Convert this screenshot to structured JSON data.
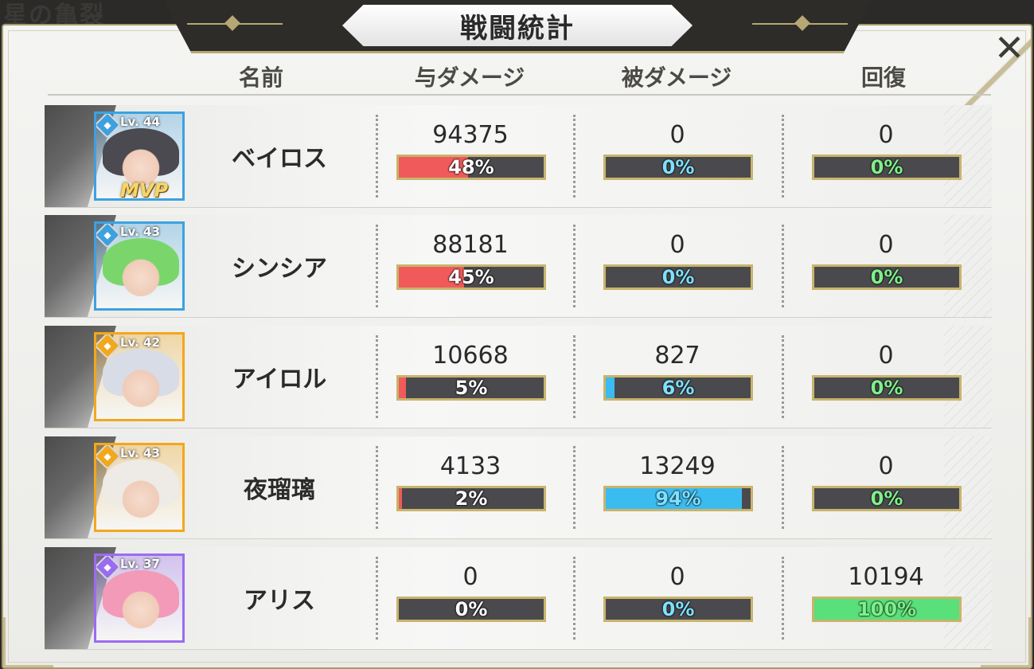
{
  "background_text": "星の亀裂",
  "title": "戦闘統計",
  "close_label": "✕",
  "headers": {
    "name": "名前",
    "dealt": "与ダメージ",
    "taken": "被ダメージ",
    "heal": "回復"
  },
  "colors": {
    "dealt": "#f05a5a",
    "taken": "#3bbcf0",
    "heal": "#5ae07a",
    "dealt_text": "#ffffff",
    "taken_text": "#7fe0ff",
    "heal_text": "#7ff08a"
  },
  "rows": [
    {
      "name": "ベイロス",
      "level": "Lv. 44",
      "class_icon": "bow-icon",
      "frame_color": "#3da1e0",
      "hair_color": "#4a4a50",
      "mvp": "MVP",
      "dealt": "94375",
      "dealt_pct": "48%",
      "dealt_frac": 0.48,
      "taken": "0",
      "taken_pct": "0%",
      "taken_frac": 0,
      "heal": "0",
      "heal_pct": "0%",
      "heal_frac": 0
    },
    {
      "name": "シンシア",
      "level": "Lv. 43",
      "class_icon": "female-icon",
      "frame_color": "#3da1e0",
      "hair_color": "#7ad66a",
      "mvp": "",
      "dealt": "88181",
      "dealt_pct": "45%",
      "dealt_frac": 0.45,
      "taken": "0",
      "taken_pct": "0%",
      "taken_frac": 0,
      "heal": "0",
      "heal_pct": "0%",
      "heal_frac": 0
    },
    {
      "name": "アイロル",
      "level": "Lv. 42",
      "class_icon": "bow-icon",
      "frame_color": "#f2a81c",
      "hair_color": "#d8dce6",
      "mvp": "",
      "dealt": "10668",
      "dealt_pct": "5%",
      "dealt_frac": 0.05,
      "taken": "827",
      "taken_pct": "6%",
      "taken_frac": 0.06,
      "heal": "0",
      "heal_pct": "0%",
      "heal_frac": 0
    },
    {
      "name": "夜瑠璃",
      "level": "Lv. 43",
      "class_icon": "shield-icon",
      "frame_color": "#f2a81c",
      "hair_color": "#eeeae6",
      "mvp": "",
      "dealt": "4133",
      "dealt_pct": "2%",
      "dealt_frac": 0.02,
      "taken": "13249",
      "taken_pct": "94%",
      "taken_frac": 0.94,
      "heal": "0",
      "heal_pct": "0%",
      "heal_frac": 0
    },
    {
      "name": "アリス",
      "level": "Lv. 37",
      "class_icon": "heal-cross-icon",
      "frame_color": "#9a6cf0",
      "hair_color": "#f29ab8",
      "mvp": "",
      "dealt": "0",
      "dealt_pct": "0%",
      "dealt_frac": 0,
      "taken": "0",
      "taken_pct": "0%",
      "taken_frac": 0,
      "heal": "10194",
      "heal_pct": "100%",
      "heal_frac": 1.0
    }
  ]
}
